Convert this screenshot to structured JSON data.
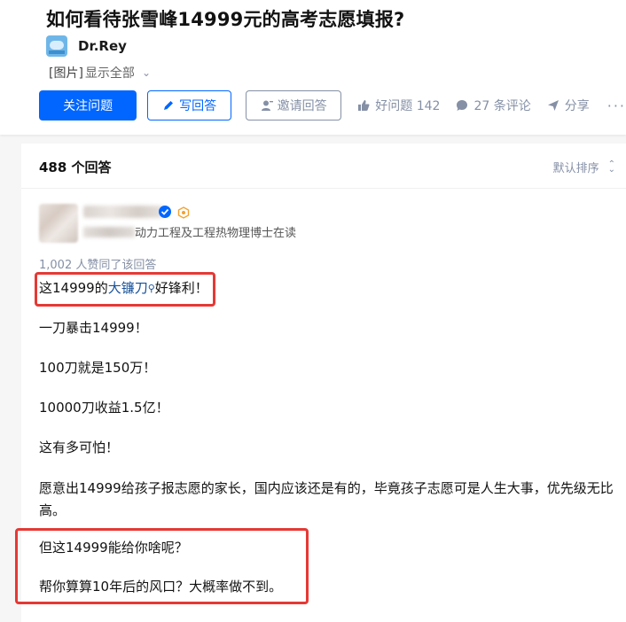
{
  "question": {
    "title": "如何看待张雪峰14999元的高考志愿填报?",
    "author": "Dr.Rey",
    "image_tag": "[图片]",
    "show_all": "显示全部"
  },
  "actions": {
    "follow": "关注问题",
    "write": "写回答",
    "invite": "邀请回答",
    "good_question": "好问题 142",
    "comments": "27 条评论",
    "share": "分享",
    "more": "···"
  },
  "answers_bar": {
    "count": "488 个回答",
    "sort": "默认排序"
  },
  "answer": {
    "bio": "动力工程及工程热物理博士在读",
    "upvotes": "1,002 人赞同了该回答",
    "p1_before": "这14999的",
    "p1_link": "大镰刀",
    "p1_after": "好锋利！",
    "p2": "一刀暴击14999！",
    "p3": "100刀就是150万！",
    "p4": "10000刀收益1.5亿！",
    "p5": "这有多可怕！",
    "p6": "愿意出14999给孩子报志愿的家长，国内应该还是有的，毕竟孩子志愿可是人生大事，优先级无比高。",
    "p7": "但这14999能给你啥呢？",
    "p8": "帮你算算10年后的风口？大概率做不到。"
  },
  "colors": {
    "brand": "#0066ff",
    "highlight_box": "#e53935",
    "muted": "#8590a6",
    "link": "#175199"
  },
  "icons": [
    "pencil-icon",
    "invite-user-icon",
    "thumbs-up-icon",
    "comment-icon",
    "share-icon",
    "chevron-down-icon",
    "sort-icon",
    "verified-badge-icon",
    "medal-icon",
    "search-icon"
  ]
}
